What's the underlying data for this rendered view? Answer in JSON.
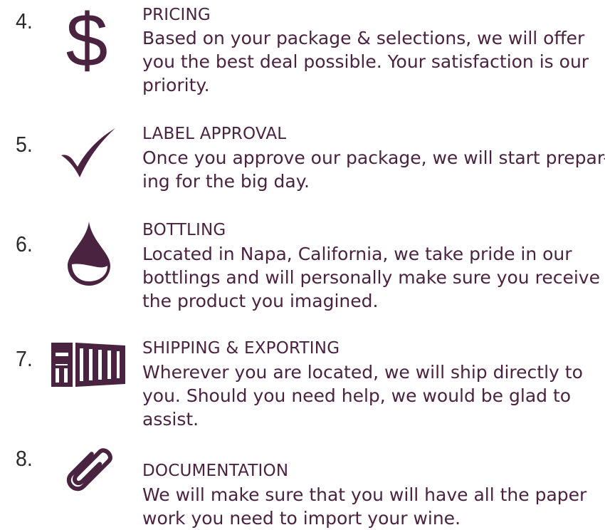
{
  "colors": {
    "accent": "#4a2340",
    "number": "#2b2b2b",
    "background": "#ffffff"
  },
  "steps": [
    {
      "number": "4.",
      "icon": "dollar-sign-icon",
      "title": "PRICING",
      "description_lines": [
        "Based on your package & selections, we will offer",
        "you the best deal possible. Your satisfaction is our",
        "priority."
      ]
    },
    {
      "number": "5.",
      "icon": "checkmark-icon",
      "title": "LABEL APPROVAL",
      "description_lines": [
        "Once you approve our package, we will start prepar-",
        "ing for the big day."
      ]
    },
    {
      "number": "6.",
      "icon": "drop-icon",
      "title": "BOTTLING",
      "description_lines": [
        "Located in Napa, California, we take pride in our",
        "bottlings and will personally make sure you receive",
        "the product you imagined."
      ]
    },
    {
      "number": "7.",
      "icon": "shipping-container-icon",
      "title": "SHIPPING & EXPORTING",
      "description_lines": [
        "Wherever you are located, we will ship directly to",
        "you. Should you need help, we would be glad to",
        "assist."
      ]
    },
    {
      "number": "8.",
      "icon": "paperclip-icon",
      "title": "DOCUMENTATION",
      "description_lines": [
        "We will make sure that you will have all the paper",
        "work you need to import your wine."
      ]
    }
  ]
}
